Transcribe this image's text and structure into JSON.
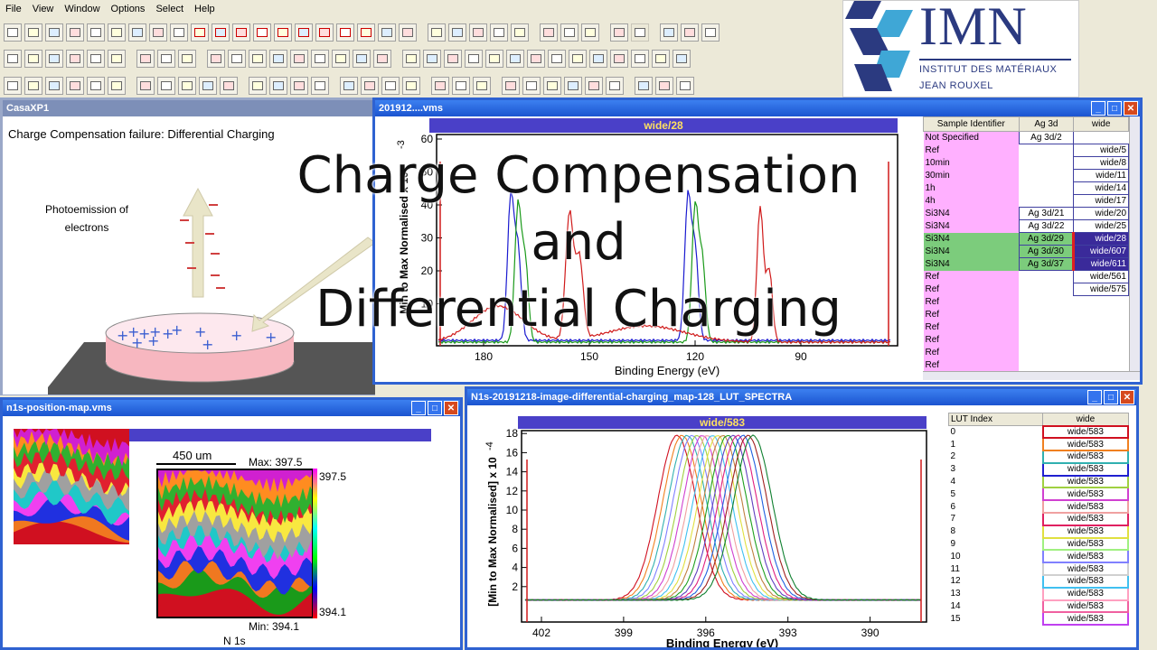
{
  "menu": [
    "File",
    "View",
    "Window",
    "Options",
    "Select",
    "Help"
  ],
  "toolbar_rows": [
    [
      "new",
      "open",
      "open-folder",
      "save",
      "copy",
      "copy2",
      "copy3",
      "copy4",
      "doc",
      "rec1",
      "rec2",
      "rec3",
      "rec4",
      "rec5",
      "rec6",
      "rec7",
      "rec8",
      "rec9",
      "chart",
      "print",
      "sep",
      "win1",
      "win2",
      "win3",
      "arrow",
      "cut",
      "sep",
      "tile1",
      "tile2",
      "tile3",
      "sep",
      "bag",
      "del",
      "sep",
      "d1",
      "d2",
      "help"
    ],
    [
      "t1",
      "t2",
      "t3",
      "t4",
      "t5",
      "t6",
      "sep",
      "a1",
      "a2",
      "a3",
      "sep",
      "b1",
      "b2",
      "b3",
      "b4",
      "b5",
      "b6",
      "KE",
      "CPS",
      "XY",
      "sep",
      "c1",
      "c2",
      "c3",
      "BG",
      "SUB",
      "AN",
      "Calib",
      "Blank",
      "Exp",
      "Exp",
      "EL",
      "fx",
      "fx2",
      "EDIT MODE"
    ],
    [
      "u1",
      "u2",
      "u3",
      "u4",
      "u5",
      "u6",
      "sep",
      "v1",
      "v2",
      "v3",
      "v4",
      "v5",
      "sep",
      "TOF",
      "w1",
      "w2",
      "w3",
      "sep",
      "x1",
      "x2",
      "x3",
      "x4",
      "sep",
      "y1",
      "AA",
      "y3",
      "sep",
      "z1",
      "z2",
      "z3",
      "z4",
      "z5",
      "z6",
      "sep",
      "q1",
      "q2",
      "q3"
    ]
  ],
  "logo": {
    "main": "IMN",
    "sub1": "INSTITUT DES MATÉRIAUX",
    "sub2": "JEAN ROUXEL"
  },
  "casa_window": {
    "title": "CasaXP1",
    "heading": "Charge Compensation failure: Differential Charging",
    "photo_label_1": "Photoemission of",
    "photo_label_2": "electrons"
  },
  "overlay": {
    "line1": "Charge Compensation",
    "line2": "and",
    "line3": "Differential Charging"
  },
  "spectrum_window": {
    "title": "201912....vms",
    "plot_title": "wide/28",
    "ylabel": "Min to Max Normalised x 10",
    "yexp": "-3",
    "xlabel": "Binding Energy (eV)",
    "yticks": [
      "10",
      "20",
      "30",
      "40",
      "50",
      "60"
    ],
    "xticks": [
      "180",
      "150",
      "120",
      "90"
    ],
    "table_headers": [
      "Sample Identifier",
      "Ag 3d",
      "wide"
    ],
    "rows": [
      [
        "Not Specified",
        "Ag 3d/2",
        ""
      ],
      [
        "Ref",
        "",
        "wide/5"
      ],
      [
        "10min",
        "",
        "wide/8"
      ],
      [
        "30min",
        "",
        "wide/11"
      ],
      [
        "1h",
        "",
        "wide/14"
      ],
      [
        "4h",
        "",
        "wide/17"
      ],
      [
        "Si3N4",
        "Ag 3d/21",
        "wide/20"
      ],
      [
        "Si3N4",
        "Ag 3d/22",
        "wide/25"
      ],
      [
        "Si3N4",
        "Ag 3d/29",
        "wide/28"
      ],
      [
        "Si3N4",
        "Ag 3d/30",
        "wide/607"
      ],
      [
        "Si3N4",
        "Ag 3d/37",
        "wide/611"
      ],
      [
        "Ref",
        "",
        "wide/561"
      ],
      [
        "Ref",
        "",
        "wide/575"
      ],
      [
        "Ref",
        "",
        ""
      ],
      [
        "Ref",
        "",
        ""
      ],
      [
        "Ref",
        "",
        ""
      ],
      [
        "Ref",
        "",
        ""
      ],
      [
        "Ref",
        "",
        ""
      ],
      [
        "Ref",
        "",
        ""
      ]
    ]
  },
  "map_window": {
    "title": "n1s-position-map.vms",
    "scale": "450 um",
    "max": "Max: 397.5",
    "min": "Min: 394.1",
    "top_val": "397.5",
    "bot_val": "394.1",
    "label": "N 1s"
  },
  "lut_window": {
    "title": "N1s-20191218-image-differential-charging_map-128_LUT_SPECTRA",
    "plot_title": "wide/583",
    "ylabel": "[Min to Max Normalised]  x 10",
    "yexp": "-4",
    "xlabel": "Binding Energy (eV)",
    "yticks": [
      "2",
      "4",
      "6",
      "8",
      "10",
      "12",
      "14",
      "16",
      "18"
    ],
    "xticks": [
      "402",
      "399",
      "396",
      "393",
      "390"
    ],
    "table_headers": [
      "LUT Index",
      "wide"
    ],
    "rows": [
      "0",
      "1",
      "2",
      "3",
      "4",
      "5",
      "6",
      "7",
      "8",
      "9",
      "10",
      "11",
      "12",
      "13",
      "14",
      "15"
    ],
    "cell": "wide/583"
  },
  "colors": {
    "titlebar": "#1b54d0",
    "plot_header": "#4a40c8",
    "pink": "#ffb0ff",
    "green": "#7ccc7c"
  }
}
